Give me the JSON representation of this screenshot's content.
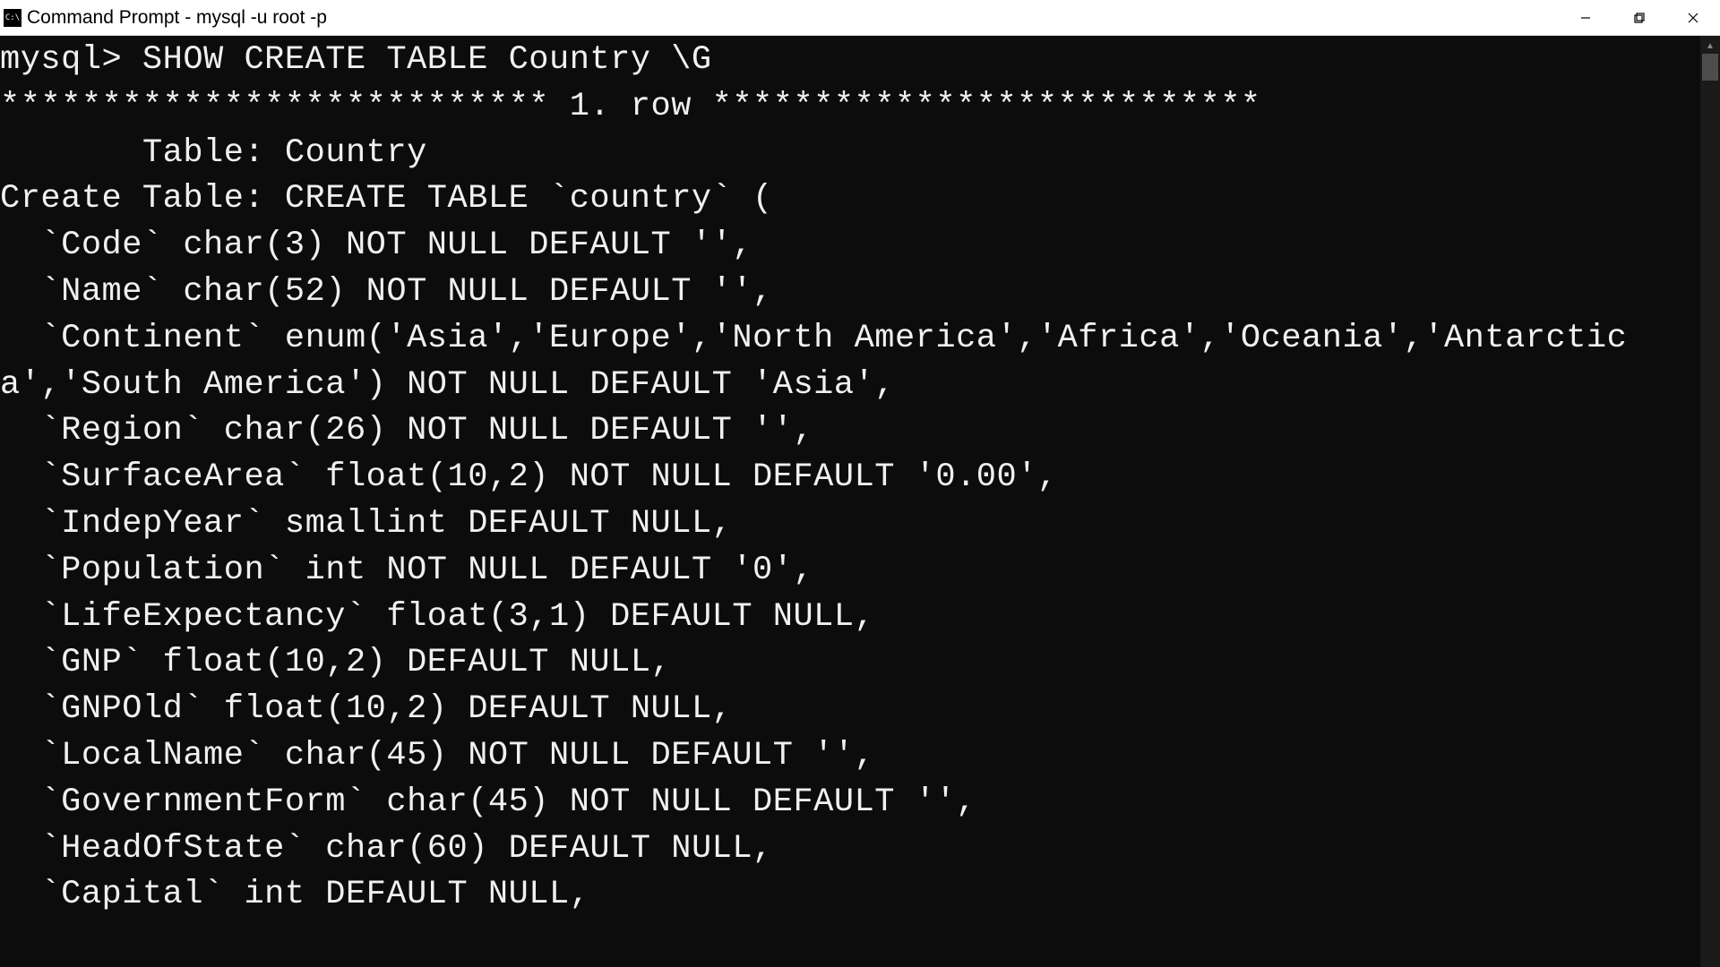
{
  "window": {
    "title": "Command Prompt - mysql  -u root -p",
    "icon_label": "C:\\"
  },
  "terminal": {
    "prompt": "mysql>",
    "command": "SHOW CREATE TABLE Country \\G",
    "row_header": "*************************** 1. row ***************************",
    "table_label": "       Table:",
    "table_name": "Country",
    "create_label": "Create Table:",
    "create_statement_lines": [
      "CREATE TABLE `country` (",
      "  `Code` char(3) NOT NULL DEFAULT '',",
      "  `Name` char(52) NOT NULL DEFAULT '',",
      "  `Continent` enum('Asia','Europe','North America','Africa','Oceania','Antarctica','South America') NOT NULL DEFAULT 'Asia',",
      "  `Region` char(26) NOT NULL DEFAULT '',",
      "  `SurfaceArea` float(10,2) NOT NULL DEFAULT '0.00',",
      "  `IndepYear` smallint DEFAULT NULL,",
      "  `Population` int NOT NULL DEFAULT '0',",
      "  `LifeExpectancy` float(3,1) DEFAULT NULL,",
      "  `GNP` float(10,2) DEFAULT NULL,",
      "  `GNPOld` float(10,2) DEFAULT NULL,",
      "  `LocalName` char(45) NOT NULL DEFAULT '',",
      "  `GovernmentForm` char(45) NOT NULL DEFAULT '',",
      "  `HeadOfState` char(60) DEFAULT NULL,",
      "  `Capital` int DEFAULT NULL,"
    ]
  }
}
